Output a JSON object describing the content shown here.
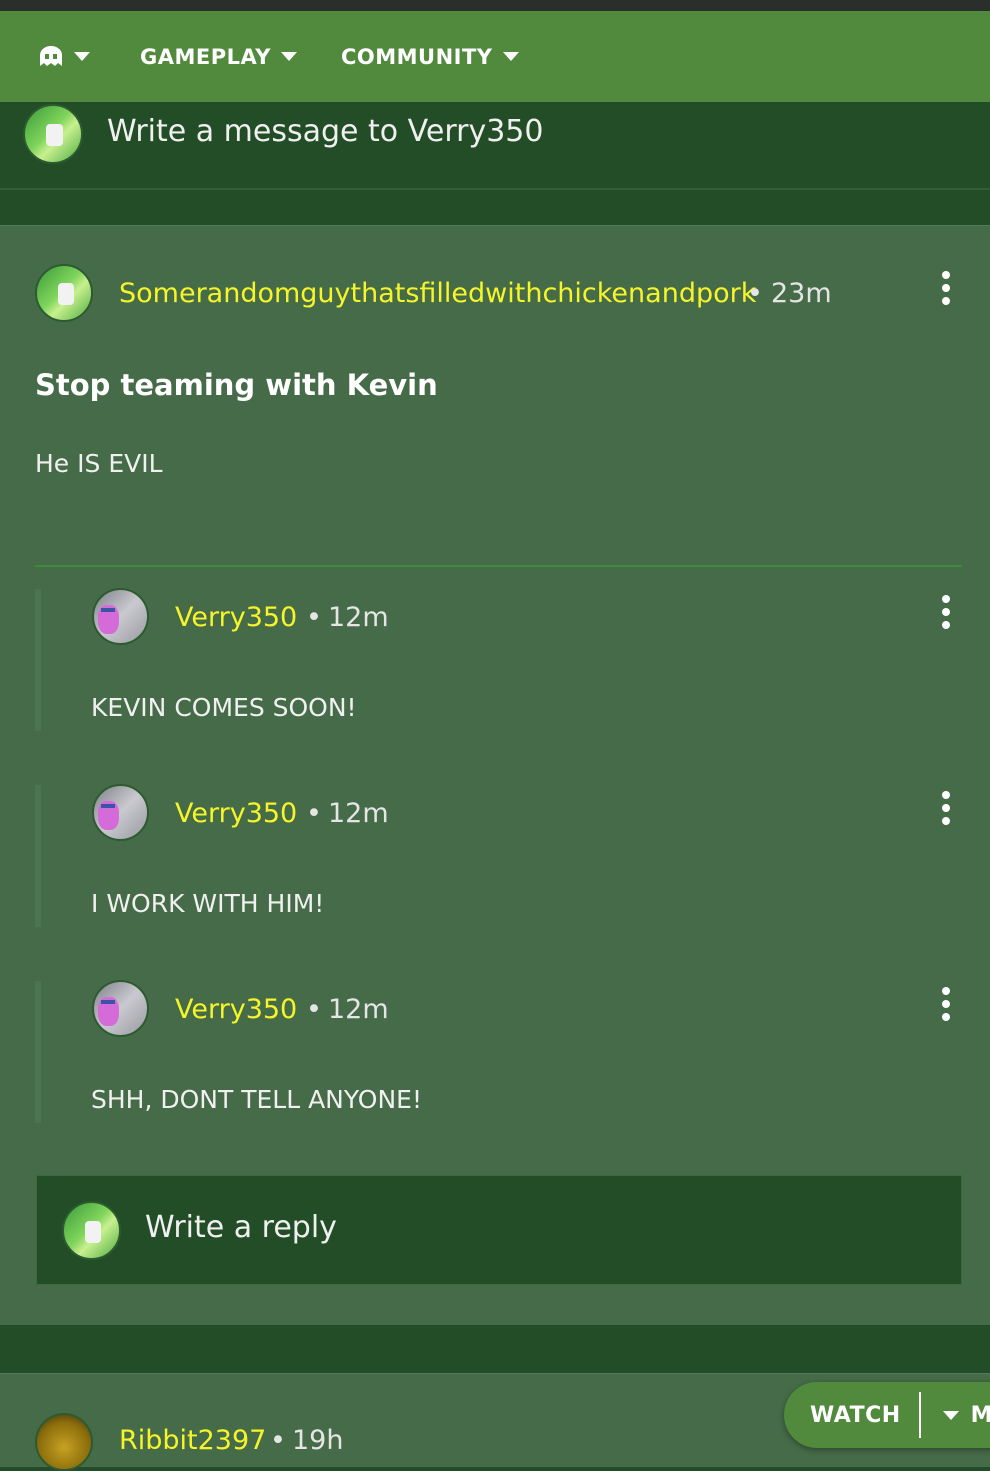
{
  "nav": {
    "items": [
      {
        "label": ""
      },
      {
        "label": "GAMEPLAY"
      },
      {
        "label": "COMMUNITY"
      }
    ]
  },
  "message_composer": {
    "placeholder": "Write a message to Verry350"
  },
  "post": {
    "author": "Somerandomguythatsfilledwithchickenandpork",
    "separator": "•",
    "time": "23m",
    "title": "Stop teaming with Kevin",
    "body": "He IS EVIL",
    "replies": [
      {
        "author": "Verry350",
        "separator": "•",
        "time": "12m",
        "body": "KEVIN COMES SOON!"
      },
      {
        "author": "Verry350",
        "separator": "•",
        "time": "12m",
        "body": "I WORK WITH HIM!"
      },
      {
        "author": "Verry350",
        "separator": "•",
        "time": "12m",
        "body": "SHH, DONT TELL ANYONE!"
      }
    ],
    "reply_composer": {
      "placeholder": "Write a reply"
    }
  },
  "next_post": {
    "author": "Ribbit2397",
    "separator": "•",
    "time": "19h"
  },
  "floating_bar": {
    "watch_label": "WATCH",
    "my_label": "MY"
  },
  "colors": {
    "nav_bg": "#528a3d",
    "page_bg": "#234d27",
    "card_bg": "#456b48",
    "username": "#f5f52a"
  },
  "icons": {
    "nav_logo": "ghost-logo-icon",
    "menu": "kebab-menu-icon",
    "dropdown": "caret-down-icon"
  }
}
